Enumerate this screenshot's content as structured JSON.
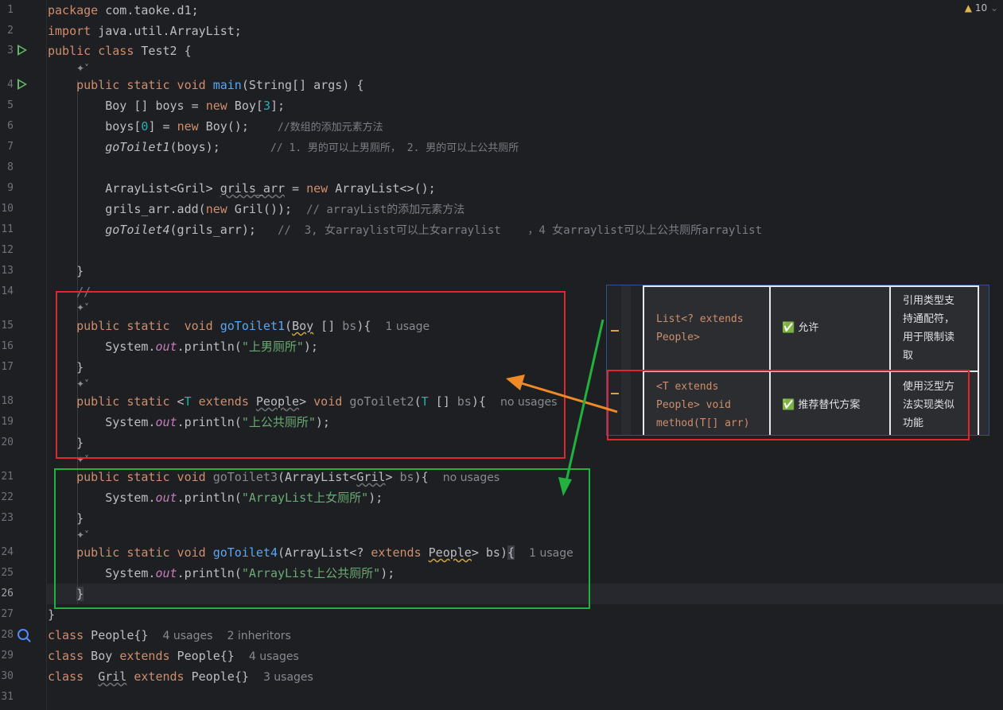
{
  "editor": {
    "warning_count": "10",
    "line_numbers": [
      "1",
      "2",
      "3",
      "4",
      "5",
      "6",
      "7",
      "8",
      "9",
      "10",
      "11",
      "12",
      "13",
      "14",
      "15",
      "16",
      "17",
      "18",
      "19",
      "20",
      "21",
      "22",
      "23",
      "24",
      "25",
      "26",
      "27",
      "28",
      "29",
      "30",
      "31"
    ],
    "code": {
      "l1": [
        "package",
        " com.taoke.d1;"
      ],
      "l2": [
        "import",
        " java.util.ArrayList;"
      ],
      "l3": [
        "public class",
        " Test2 {"
      ],
      "l4": [
        "public static void",
        " ",
        "main",
        "(String[] args) {"
      ],
      "l5": [
        "Boy [] boys = ",
        "new",
        " Boy[",
        "3",
        "];"
      ],
      "l6": [
        "boys[",
        "0",
        "] = ",
        "new",
        " Boy();    ",
        "//数组的添加元素方法"
      ],
      "l7": [
        "goToilet1",
        "(boys);       ",
        "// 1. 男的可以上男厕所， 2. 男的可以上公共厕所"
      ],
      "l9": [
        "ArrayList<Gril> ",
        "grils_arr",
        " = ",
        "new",
        " ArrayList<>();"
      ],
      "l10": [
        "grils_arr.add(",
        "new",
        " Gril());  ",
        "// arrayList的添加元素方法"
      ],
      "l11": [
        "goToilet4",
        "(grils_arr);   ",
        "//  3, 女arraylist可以上女arraylist    ，4 女arraylist可以上公共厕所arraylist"
      ],
      "l13": "}",
      "l14": "//",
      "l15": [
        "public static",
        "  ",
        "void",
        " ",
        "goToilet1",
        "(",
        "Boy",
        " [] ",
        "bs",
        "){",
        "1 usage"
      ],
      "l16": [
        "System.",
        "out",
        ".println(",
        "\"上男厕所\"",
        ");"
      ],
      "l17": "}",
      "l18": [
        "public static",
        " <",
        "T",
        " ",
        "extends",
        " ",
        "People",
        "> ",
        "void",
        " ",
        "goToilet2",
        "(",
        "T",
        " [] ",
        "bs",
        "){",
        "no usages"
      ],
      "l19": [
        "System.",
        "out",
        ".println(",
        "\"上公共厕所\"",
        ");"
      ],
      "l20": "}",
      "l21": [
        "public static void",
        " ",
        "goToilet3",
        "(ArrayList<",
        "Gril",
        "> ",
        "bs",
        "){",
        "no usages"
      ],
      "l22": [
        "System.",
        "out",
        ".println(",
        "\"ArrayList上女厕所\"",
        ");"
      ],
      "l23": "}",
      "l24": [
        "public static void",
        " ",
        "goToilet4",
        "(ArrayList<? ",
        "extends",
        " ",
        "People",
        "> bs)",
        "{",
        "1 usage"
      ],
      "l25": [
        "System.",
        "out",
        ".println(",
        "\"ArrayList上公共厕所\"",
        ");"
      ],
      "l26": "}",
      "l27": "}",
      "l28": [
        "class",
        " People",
        "{}",
        "4 usages",
        "2 inheritors"
      ],
      "l29": [
        "class",
        " Boy ",
        "extends",
        " People",
        "{}",
        "4 usages"
      ],
      "l30": [
        "class",
        "  ",
        "Gril",
        " ",
        "extends",
        " People",
        "{}",
        "3 usages"
      ]
    },
    "ai_icon": "✦˅"
  },
  "table": {
    "row1": {
      "syntax": [
        "List<? extends",
        "People>"
      ],
      "ok": "✅ 允许",
      "note": [
        "引用类型支",
        "持通配符，",
        "用于限制读",
        "取"
      ]
    },
    "row2": {
      "syntax": [
        "<T extends",
        "People> void",
        "method(T[] arr)"
      ],
      "ok": "✅ 推荐替代方案",
      "note": [
        "使用泛型方",
        "法实现类似",
        "功能"
      ]
    }
  },
  "colors": {
    "red_box": "#e3262b",
    "green_box": "#22b13f",
    "orange_arrow": "#f08a24",
    "green_arrow": "#22b13f"
  }
}
